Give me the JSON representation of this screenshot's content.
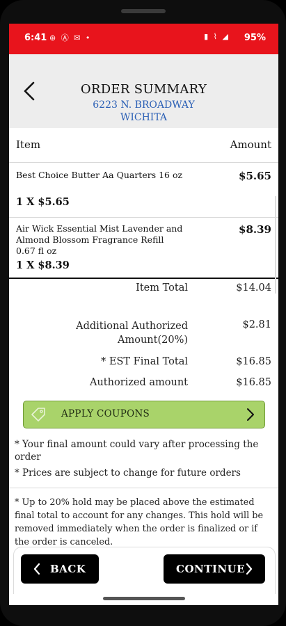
{
  "status": {
    "time": "6:41",
    "left_icons": "⊛ Ⓐ ✉ •",
    "right_icons": "▮ ⌇ ◢",
    "battery": "95%"
  },
  "header": {
    "title": "ORDER SUMMARY",
    "address_line1": "6223 N. BROADWAY",
    "address_line2": "WICHITA"
  },
  "table": {
    "col_item": "Item",
    "col_amount": "Amount",
    "items": [
      {
        "name": "Best Choice Butter Aa Quarters 16 oz",
        "qty": "1 X $5.65",
        "amount": "$5.65"
      },
      {
        "name": "Air Wick Essential Mist Lavender and Almond Blossom Fragrance Refill 0.67 fl oz",
        "qty": "1 X $8.39",
        "amount": "$8.39"
      }
    ]
  },
  "summary": {
    "item_total_label": "Item Total",
    "item_total_value": "$14.04",
    "additional_label_1": "Additional Authorized",
    "additional_label_2": "Amount(20%)",
    "additional_value": "$2.81",
    "est_final_label": "* EST Final Total",
    "est_final_value": "$16.85",
    "authorized_label": "Authorized amount",
    "authorized_value": "$16.85"
  },
  "coupon": {
    "label": "APPLY COUPONS"
  },
  "notes": {
    "note1": "* Your final amount could vary after processing the order",
    "note2": "* Prices are subject to change for future orders",
    "hold": "* Up to 20% hold may be placed above the estimated final total to account for any changes. This hold will be removed immediately when the order is finalized or if the order is canceled."
  },
  "buttons": {
    "back": "BACK",
    "continue": "CONTINUE"
  },
  "colors": {
    "status_bar": "#e8141c",
    "address": "#2a5fb5",
    "coupon_bg": "#a9d36a",
    "button_bg": "#000000"
  },
  "icons": [
    "back-arrow-icon",
    "tag-icon",
    "chevron-right-icon",
    "chevron-left-icon"
  ]
}
